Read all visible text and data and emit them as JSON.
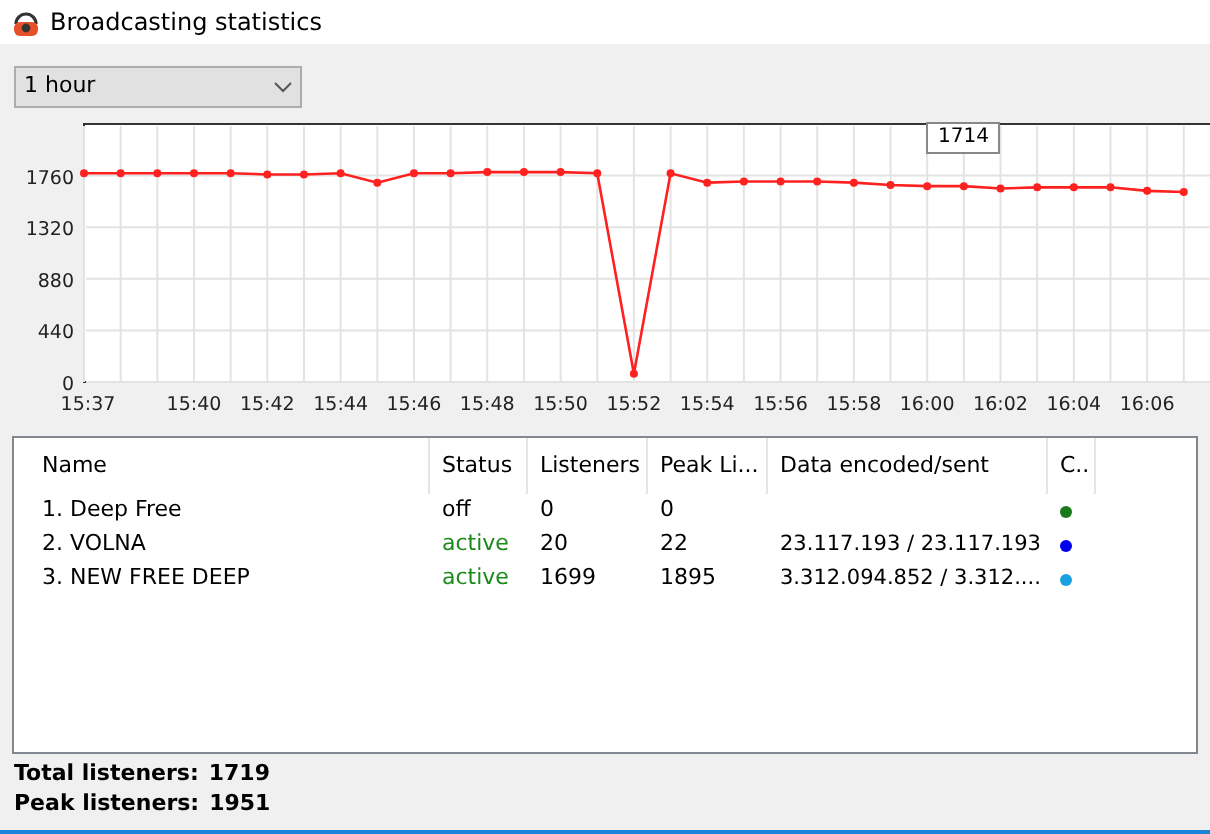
{
  "window": {
    "title": "Broadcasting statistics"
  },
  "period_select": {
    "value": "1 hour"
  },
  "chart": {
    "tooltip": "1714",
    "chart_data": {
      "type": "line",
      "ylim": [
        0,
        2200
      ],
      "yticks": [
        0,
        440,
        880,
        1320,
        1760
      ],
      "grid": true,
      "categories": [
        "15:37",
        null,
        null,
        "15:40",
        null,
        "15:42",
        null,
        "15:44",
        null,
        "15:46",
        null,
        "15:48",
        null,
        "15:50",
        null,
        "15:52",
        null,
        "15:54",
        null,
        "15:56",
        null,
        "15:58",
        null,
        "16:00",
        null,
        "16:02",
        null,
        "16:04",
        null,
        "16:06",
        null
      ],
      "series": [
        {
          "color": "#ff2020",
          "marker": true,
          "values": [
            1780,
            1780,
            1780,
            1780,
            1780,
            1770,
            1770,
            1780,
            1700,
            1780,
            1780,
            1790,
            1790,
            1790,
            1780,
            70,
            1780,
            1700,
            1710,
            1710,
            1710,
            1700,
            1680,
            1670,
            1670,
            1650,
            1660,
            1660,
            1660,
            1630,
            1620
          ]
        }
      ]
    }
  },
  "table": {
    "columns": [
      "Name",
      "Status",
      "Listeners",
      "Peak Li...",
      "Data encoded/sent",
      "C.."
    ],
    "rows": [
      {
        "name": "1. Deep Free",
        "status": "off",
        "active": false,
        "listeners": "0",
        "peak": "0",
        "data": "",
        "color": "#1a7a1a"
      },
      {
        "name": "2. VOLNA",
        "status": "active",
        "active": true,
        "listeners": "20",
        "peak": "22",
        "data": "23.117.193 / 23.117.193",
        "color": "#0000ee"
      },
      {
        "name": "3. NEW FREE DEEP",
        "status": "active",
        "active": true,
        "listeners": "1699",
        "peak": "1895",
        "data": "3.312.094.852 / 3.312....",
        "color": "#1ba1e2"
      }
    ]
  },
  "totals": [
    {
      "label": "Total listeners:",
      "value": "1719"
    },
    {
      "label": "Peak listeners:",
      "value": "1951"
    }
  ]
}
